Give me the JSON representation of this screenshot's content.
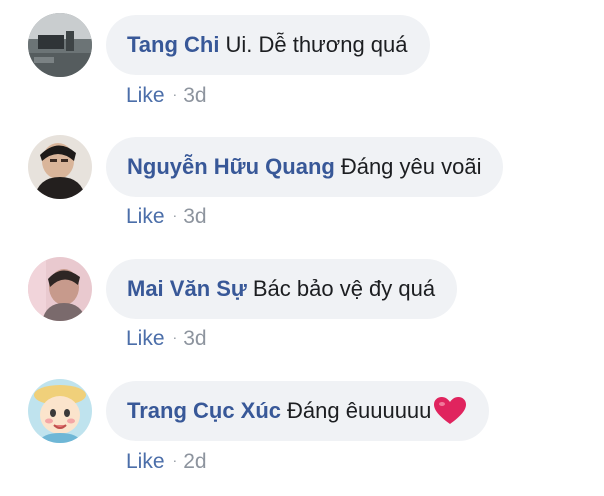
{
  "comments": [
    {
      "author": "Tang Chi",
      "text": "Ui. Dễ thương quá",
      "like_label": "Like",
      "separator": "·",
      "time": "3d",
      "avatar_icon": "photo-avatar-icon"
    },
    {
      "author": "Nguyễn Hữu Quang",
      "text": "Đáng yêu voãi",
      "like_label": "Like",
      "separator": "·",
      "time": "3d",
      "avatar_icon": "photo-avatar-icon"
    },
    {
      "author": "Mai Văn Sự",
      "text": "Bác bảo vệ đy quá",
      "like_label": "Like",
      "separator": "·",
      "time": "3d",
      "avatar_icon": "photo-avatar-icon"
    },
    {
      "author": "Trang Cục Xúc",
      "text": "Đáng êuuuuuu",
      "like_label": "Like",
      "separator": "·",
      "time": "2d",
      "avatar_icon": "cartoon-avatar-icon",
      "emoji": "heart-emoji-icon"
    }
  ],
  "colors": {
    "author": "#385898",
    "like": "#4b6ea9",
    "meta": "#8d949e",
    "bubble": "#f0f2f5",
    "text": "#1c1e21",
    "heart": "#e0245e"
  }
}
